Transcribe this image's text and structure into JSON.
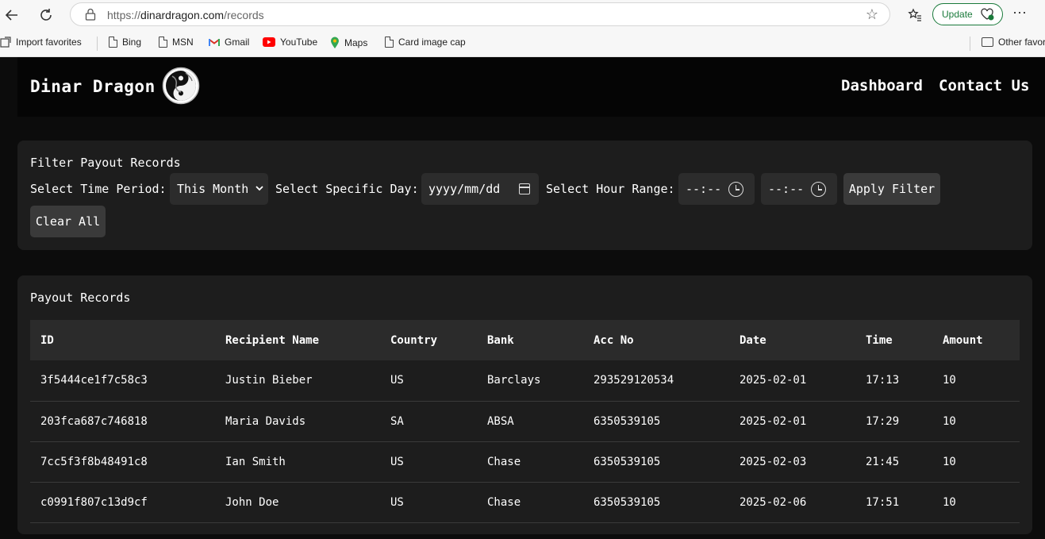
{
  "browser": {
    "url_prefix": "https://",
    "url_host": "dinardragon.com",
    "url_path": "/records",
    "update_label": "Update",
    "bookmarks": [
      {
        "label": "Import favorites",
        "icon": "import-icon"
      },
      {
        "label": "Bing",
        "icon": "page-icon"
      },
      {
        "label": "MSN",
        "icon": "page-icon"
      },
      {
        "label": "Gmail",
        "icon": "gmail-icon"
      },
      {
        "label": "YouTube",
        "icon": "youtube-icon"
      },
      {
        "label": "Maps",
        "icon": "maps-icon"
      },
      {
        "label": "Card image cap",
        "icon": "page-icon"
      }
    ],
    "other_favorites": "Other favor"
  },
  "header": {
    "brand": "Dinar Dragon",
    "nav": [
      "Dashboard",
      "Contact Us"
    ]
  },
  "filter": {
    "title": "Filter Payout Records",
    "time_period_label": "Select Time Period:",
    "time_period_value": "This Month",
    "specific_day_label": "Select Specific Day:",
    "specific_day_placeholder": "yyyy/mm/dd",
    "hour_range_label": "Select Hour Range:",
    "hour_start_placeholder": "--:--",
    "hour_end_placeholder": "--:--",
    "apply_label": "Apply Filter",
    "clear_label": "Clear All"
  },
  "records": {
    "title": "Payout Records",
    "columns": [
      "ID",
      "Recipient Name",
      "Country",
      "Bank",
      "Acc No",
      "Date",
      "Time",
      "Amount"
    ],
    "rows": [
      [
        "3f5444ce1f7c58c3",
        "Justin Bieber",
        "US",
        "Barclays",
        "293529120534",
        "2025-02-01",
        "17:13",
        "10"
      ],
      [
        "203fca687c746818",
        "Maria Davids",
        "SA",
        "ABSA",
        "6350539105",
        "2025-02-01",
        "17:29",
        "10"
      ],
      [
        "7cc5f3f8b48491c8",
        "Ian Smith",
        "US",
        "Chase",
        "6350539105",
        "2025-02-03",
        "21:45",
        "10"
      ],
      [
        "c0991f807c13d9cf",
        "John Doe",
        "US",
        "Chase",
        "6350539105",
        "2025-02-06",
        "17:51",
        "10"
      ]
    ]
  },
  "colors": {
    "page_bg": "#0c0c0c",
    "panel_bg": "#1d1d1d",
    "control_bg": "#2c2c2c",
    "update_green": "#1a7a3b"
  }
}
